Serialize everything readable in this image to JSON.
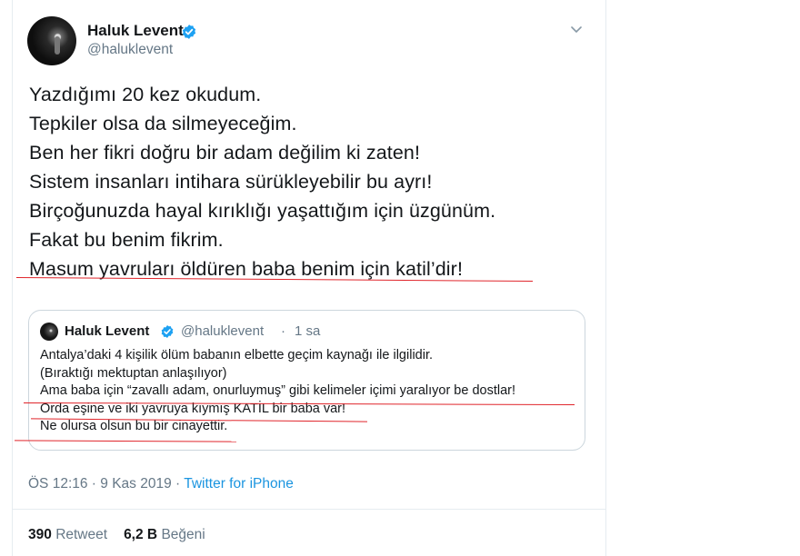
{
  "author": {
    "name": "Haluk Levent",
    "handle": "@haluklevent",
    "avatar_icon": "user-avatar-icon",
    "verified_icon": "verified-badge-icon"
  },
  "tweet": {
    "lines": [
      "Yazdığımı 20 kez okudum.",
      "Tepkiler olsa da silmeyeceğim.",
      "Ben her fikri doğru bir adam değilim ki zaten!",
      "Sistem insanları intihara sürükleyebilir bu ayrı!",
      "Birçoğunuzda hayal kırıklığı yaşattığım için üzgünüm.",
      "Fakat bu benim fikrim.",
      "Masum yavruları öldüren baba benim için katil’dir!"
    ]
  },
  "quoted_tweet": {
    "name": "Haluk Levent",
    "handle": "@haluklevent",
    "separator": "·",
    "time": "1 sa",
    "lines": [
      "Antalya’daki 4 kişilik ölüm babanın elbette geçim kaynağı ile ilgilidir.",
      "(Bıraktığı mektuptan anlaşılıyor)",
      "Ama baba için “zavallı adam, onurluymuş” gibi kelimeler içimi yaralıyor be dostlar!",
      "Orda eşine ve iki yavruya kıymış KATİL bir baba var!",
      "Ne olursa olsun bu bir cinayettir."
    ]
  },
  "meta": {
    "time": "ÖS 12:16",
    "separator1": " · ",
    "date": "9 Kas 2019",
    "separator2": " · ",
    "source": "Twitter for iPhone"
  },
  "stats": {
    "retweets_count": "390",
    "retweets_label": "Retweet",
    "likes_count": "6,2 B",
    "likes_label": "Beğeni"
  },
  "colors": {
    "text": "#14171a",
    "secondary": "#657786",
    "link": "#1b95e0",
    "verified": "#1da1f2",
    "annotation_underline": "#e0242a"
  }
}
